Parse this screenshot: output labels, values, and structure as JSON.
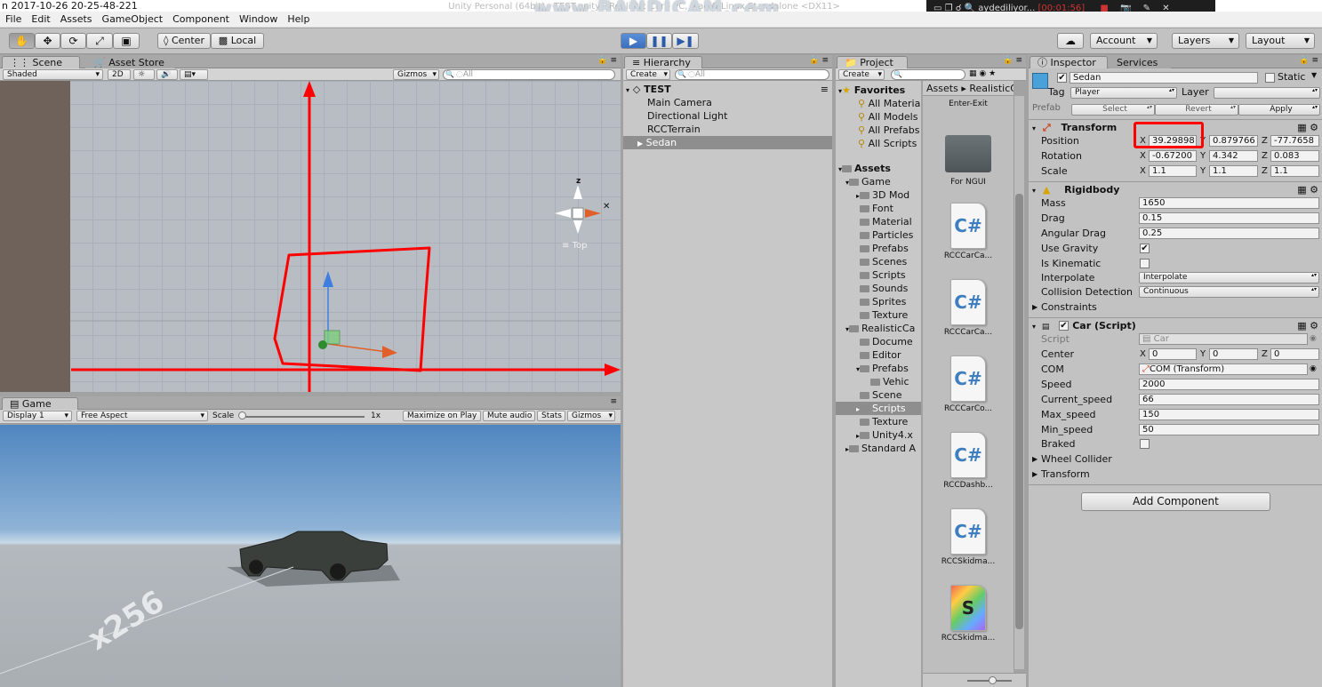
{
  "titlebar": {
    "text": "n 2017-10-26 20-25-48-221",
    "overlay": "Unity Personal (64bit) - TEST.unity - Realistic Car - PC, Mac & Linux Standalone <DX11>",
    "watermark": "www.BANDICAM.com",
    "rec_user": "aydediliyor...",
    "rec_time": "[00:01:56]"
  },
  "menu": [
    "File",
    "Edit",
    "Assets",
    "GameObject",
    "Component",
    "Window",
    "Help"
  ],
  "toolbar": {
    "pivot": "Center",
    "space": "Local",
    "account": "Account",
    "layers": "Layers",
    "layout": "Layout"
  },
  "scene": {
    "tab": "Scene",
    "tab2": "Asset Store",
    "shading": "Shaded",
    "mode2d": "2D",
    "gizmos": "Gizmos",
    "search": "◌All",
    "gizmo_label": "Top",
    "axis_z": "z"
  },
  "game": {
    "tab": "Game",
    "display": "Display 1",
    "aspect": "Free Aspect",
    "scale_label": "Scale",
    "scale_value": "1x",
    "maximize": "Maximize on Play",
    "mute": "Mute audio",
    "stats": "Stats",
    "gizmos": "Gizmos",
    "ground_text": "x256"
  },
  "hierarchy": {
    "tab": "Hierarchy",
    "create": "Create",
    "search": "◌All",
    "scene": "TEST",
    "items": [
      "Main Camera",
      "Directional Light",
      "RCCTerrain",
      "Sedan"
    ]
  },
  "project": {
    "tab": "Project",
    "create": "Create",
    "breadcrumb_assets": "Assets",
    "breadcrumb_sep": "▸",
    "breadcrumb_folder": "RealisticCa",
    "favorites": "Favorites",
    "fav_items": [
      "All Materia",
      "All Models",
      "All Prefabs",
      "All Scripts"
    ],
    "assets_root": "Assets",
    "tree": [
      {
        "label": "Game",
        "level": 1,
        "arrow": "▾"
      },
      {
        "label": "3D Mod",
        "level": 2,
        "arrow": "▸"
      },
      {
        "label": "Font",
        "level": 2,
        "arrow": ""
      },
      {
        "label": "Material",
        "level": 2,
        "arrow": ""
      },
      {
        "label": "Particles",
        "level": 2,
        "arrow": ""
      },
      {
        "label": "Prefabs",
        "level": 2,
        "arrow": ""
      },
      {
        "label": "Scenes",
        "level": 2,
        "arrow": ""
      },
      {
        "label": "Scripts",
        "level": 2,
        "arrow": ""
      },
      {
        "label": "Sounds",
        "level": 2,
        "arrow": ""
      },
      {
        "label": "Sprites",
        "level": 2,
        "arrow": ""
      },
      {
        "label": "Texture",
        "level": 2,
        "arrow": ""
      },
      {
        "label": "RealisticCa",
        "level": 1,
        "arrow": "▾"
      },
      {
        "label": "Docume",
        "level": 2,
        "arrow": ""
      },
      {
        "label": "Editor",
        "level": 2,
        "arrow": ""
      },
      {
        "label": "Prefabs",
        "level": 2,
        "arrow": "▾"
      },
      {
        "label": "Vehic",
        "level": 3,
        "arrow": ""
      },
      {
        "label": "Scene",
        "level": 2,
        "arrow": ""
      },
      {
        "label": "Scripts",
        "level": 2,
        "arrow": "▸"
      },
      {
        "label": "Texture",
        "level": 2,
        "arrow": ""
      },
      {
        "label": "Unity4.x",
        "level": 2,
        "arrow": "▸"
      },
      {
        "label": "Standard A",
        "level": 1,
        "arrow": "▸"
      }
    ],
    "assets": [
      {
        "label": "Enter-Exit",
        "kind": "cut"
      },
      {
        "label": "For NGUI",
        "kind": "folder"
      },
      {
        "label": "RCCCarCa...",
        "kind": "cs"
      },
      {
        "label": "RCCCarCa...",
        "kind": "cs"
      },
      {
        "label": "RCCCarCo...",
        "kind": "cs"
      },
      {
        "label": "RCCDashb...",
        "kind": "cs"
      },
      {
        "label": "RCCSkidma...",
        "kind": "cs"
      },
      {
        "label": "RCCSkidma...",
        "kind": "shader"
      }
    ],
    "cs_glyph": "C#",
    "shader_glyph": "S"
  },
  "inspector": {
    "tab": "Inspector",
    "tab2": "Services",
    "object_name": "Sedan",
    "static_label": "Static",
    "tag_label": "Tag",
    "tag_value": "Player",
    "layer_label": "Layer",
    "layer_value": "",
    "prefab_label": "Prefab",
    "select": "Select",
    "revert": "Revert",
    "apply": "Apply",
    "transform": {
      "title": "Transform",
      "position_label": "Position",
      "rotation_label": "Rotation",
      "scale_label": "Scale",
      "position": [
        "39.29898",
        "0.879766",
        "-77.7658"
      ],
      "rotation": [
        "-0.67200",
        "4.342",
        "0.083"
      ],
      "scale": [
        "1.1",
        "1.1",
        "1.1"
      ]
    },
    "axes": [
      "X",
      "Y",
      "Z"
    ],
    "rigidbody": {
      "title": "Rigidbody",
      "mass_label": "Mass",
      "mass": "1650",
      "drag_label": "Drag",
      "drag": "0.15",
      "angular_drag_label": "Angular Drag",
      "angular_drag": "0.25",
      "use_gravity_label": "Use Gravity",
      "use_gravity": "✔",
      "is_kinematic_label": "Is Kinematic",
      "interpolate_label": "Interpolate",
      "interpolate": "Interpolate",
      "collision_label": "Collision Detection",
      "collision": "Continuous",
      "constraints_label": "Constraints"
    },
    "car": {
      "title": "Car (Script)",
      "script_label": "Script",
      "script": "Car",
      "center_label": "Center",
      "center": [
        "0",
        "0",
        "0"
      ],
      "com_label": "COM",
      "com": "COM (Transform)",
      "speed_label": "Speed",
      "speed": "2000",
      "current_speed_label": "Current_speed",
      "current_speed": "66",
      "max_speed_label": "Max_speed",
      "max_speed": "150",
      "min_speed_label": "Min_speed",
      "min_speed": "50",
      "braked_label": "Braked"
    },
    "wheel_collider": "Wheel Collider",
    "transform_field": "Transform",
    "add_component": "Add Component"
  },
  "colors": {
    "annotation_red": "#ff0000",
    "play_blue": "#3b6fbf",
    "axis_blue": "#3d7ee0",
    "axis_orange": "#e0602a"
  }
}
